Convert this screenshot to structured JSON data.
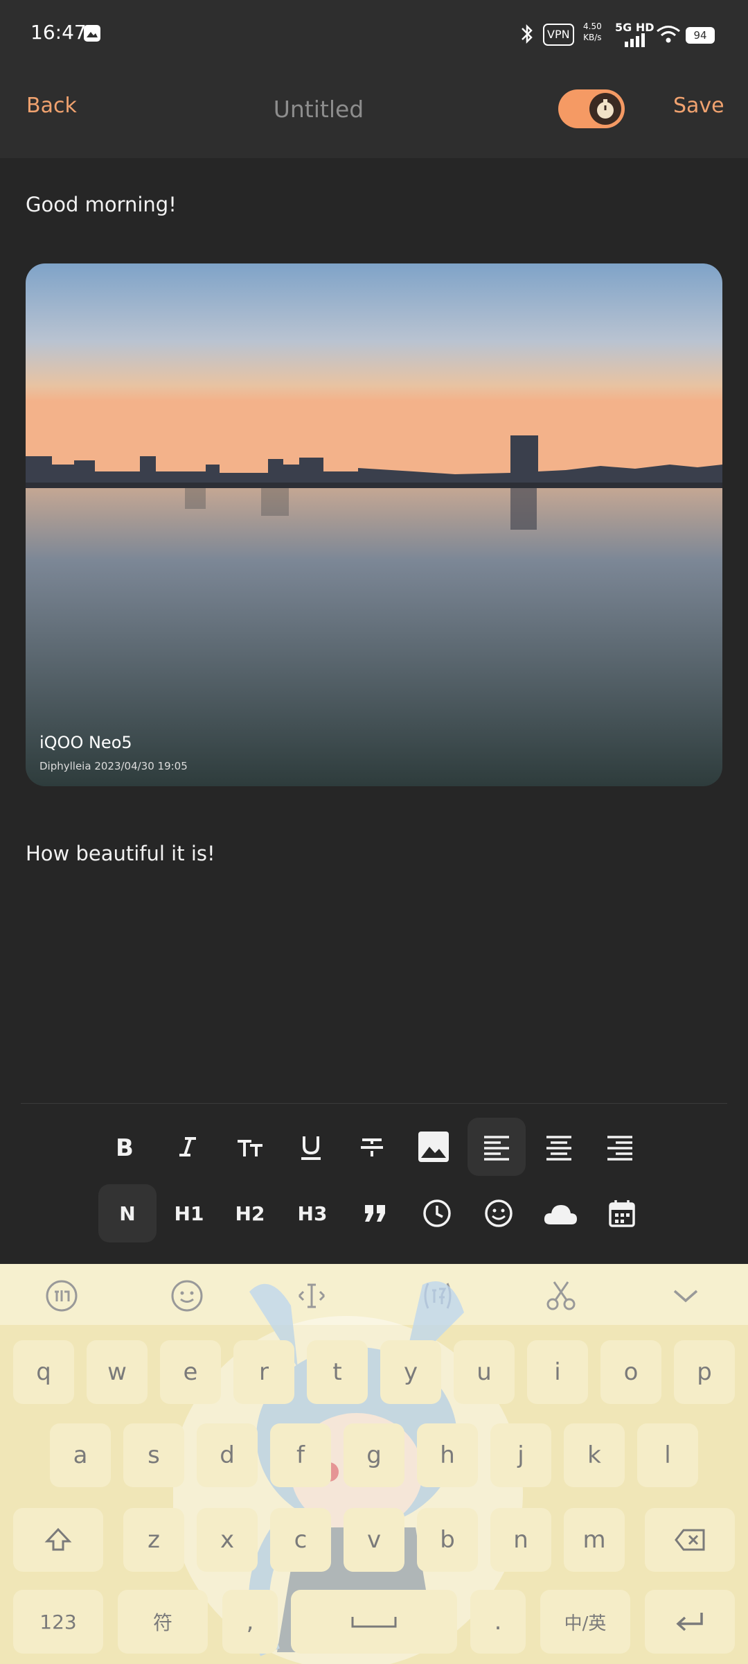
{
  "status_bar": {
    "time": "16:47",
    "vpn": "VPN",
    "speed_value": "4.50",
    "speed_unit": "KB/s",
    "network": "5G HD",
    "battery": "94"
  },
  "header": {
    "back_label": "Back",
    "title": "Untitled",
    "save_label": "Save"
  },
  "editor": {
    "text_before": "Good morning!",
    "photo": {
      "watermark_title": "iQOO Neo5",
      "watermark_sub": "Diphylleia  2023/04/30 19:05"
    },
    "text_after": "How beautiful it is!"
  },
  "toolbar": {
    "normal": "N",
    "h1": "H1",
    "h2": "H2",
    "h3": "H3"
  },
  "keyboard": {
    "row1": [
      "q",
      "w",
      "e",
      "r",
      "t",
      "y",
      "u",
      "i",
      "o",
      "p"
    ],
    "row2": [
      "a",
      "s",
      "d",
      "f",
      "g",
      "h",
      "j",
      "k",
      "l"
    ],
    "row3": [
      "z",
      "x",
      "c",
      "v",
      "b",
      "n",
      "m"
    ],
    "key_123": "123",
    "key_symbols": "符",
    "key_comma": ",",
    "key_period": ".",
    "key_lang": "中/英"
  },
  "colors": {
    "accent": "#f0a26f",
    "toggle": "#f59a64",
    "background": "#262626",
    "keyboard": "#f0e6b7"
  }
}
